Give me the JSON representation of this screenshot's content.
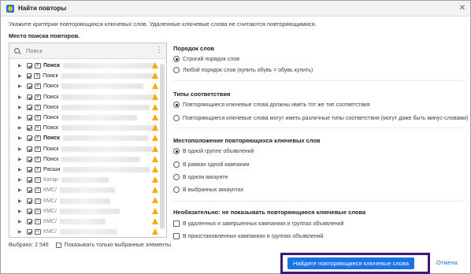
{
  "window": {
    "title": "Найти повторы",
    "close": "✕"
  },
  "info": "Укажите критерии повторяющихся ключевых слов. Удаленные ключевые слова не считаются повторяющимися.",
  "left": {
    "label": "Место поиска повторов.",
    "search_placeholder": "Поиск",
    "menu": "⋮",
    "rows": [
      {
        "name": "Поиск",
        "icon": "search",
        "bold": true,
        "active": true
      },
      {
        "name": "Поиск",
        "icon": "search",
        "bold": false,
        "active": true
      },
      {
        "name": "Поиск",
        "icon": "search",
        "bold": false,
        "active": true
      },
      {
        "name": "Поиск",
        "icon": "search",
        "bold": false,
        "active": true
      },
      {
        "name": "Поиск",
        "icon": "search",
        "bold": false,
        "active": true
      },
      {
        "name": "Поиск",
        "icon": "search",
        "bold": false,
        "active": true
      },
      {
        "name": "Поиск",
        "icon": "search",
        "bold": false,
        "active": true
      },
      {
        "name": "Поиск",
        "icon": "search",
        "bold": true,
        "active": true
      },
      {
        "name": "Поиск",
        "icon": "search",
        "bold": false,
        "active": true
      },
      {
        "name": "Поиск",
        "icon": "search",
        "bold": false,
        "active": true
      },
      {
        "name": "Расши",
        "icon": "search",
        "bold": false,
        "active": true
      },
      {
        "name": "Катар",
        "icon": "display",
        "bold": false,
        "active": false
      },
      {
        "name": "КМС/",
        "icon": "display",
        "bold": false,
        "active": false
      },
      {
        "name": "КМС/",
        "icon": "display",
        "bold": false,
        "active": false
      },
      {
        "name": "КМС/",
        "icon": "display",
        "bold": false,
        "active": false
      },
      {
        "name": "КМС/",
        "icon": "display",
        "bold": false,
        "active": false
      },
      {
        "name": "КМС/",
        "icon": "display",
        "bold": false,
        "active": false
      }
    ],
    "selected_count": "Выбрано: 2 546",
    "show_selected": "Показывать только выбранные элементы"
  },
  "order": {
    "title": "Порядок слов",
    "options": [
      "Строгий порядок слов",
      "Любой порядок слов (купить обувь = обувь купить)"
    ],
    "selected": 0
  },
  "match": {
    "title": "Типы соответствия",
    "options": [
      "Повторяющиеся ключевые слова должны иметь тот же тип соответствия",
      "Повторяющиеся ключевые слова могут иметь различные типы соответствия (могут даже быть минус-словами)"
    ],
    "selected": 0
  },
  "location": {
    "title": "Местоположение повторяющихся ключевых слов",
    "options": [
      "В одной группе объявлений",
      "В рамках одной кампании",
      "В одном аккаунте",
      "В выбранных аккаунтах"
    ],
    "selected": 0
  },
  "optional": {
    "title": "Необязательно: не показывать повторяющиеся ключевые слова",
    "options": [
      "В удаленных и завершенных кампаниях и группах объявлений",
      "В приостановленных кампаниях и группах объявлений"
    ]
  },
  "actions": {
    "find": "Найдите повторяющиеся ключевые слова",
    "cancel": "Отмена"
  },
  "colors": {
    "accent": "#1a73e8",
    "warning": "#f9ab00",
    "highlight_frame": "#3b1a78"
  }
}
